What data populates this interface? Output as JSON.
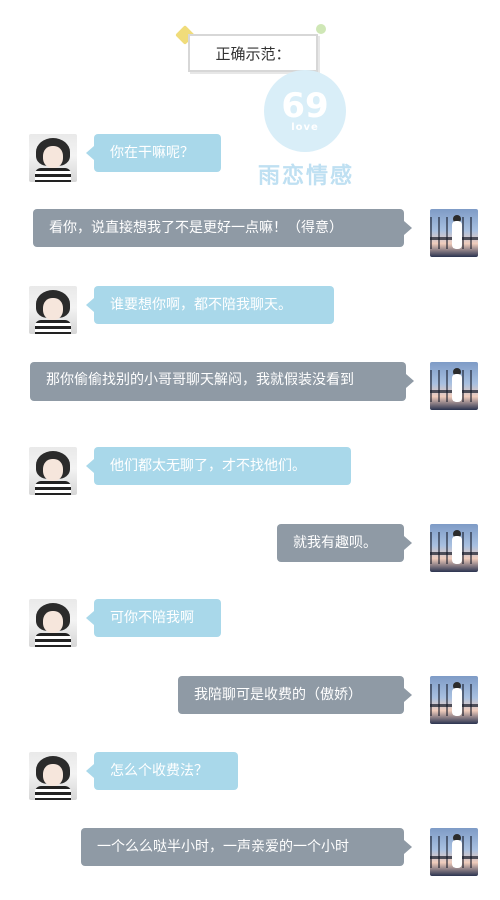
{
  "header": {
    "title": "正确示范："
  },
  "watermark": {
    "number": "69",
    "small_text": "love",
    "brand": "雨恋情感"
  },
  "colors": {
    "left_bubble": "#a9d8ea",
    "right_bubble": "#8f9aa5",
    "bubble_text": "#ffffff"
  },
  "messages": [
    {
      "side": "left",
      "avatar": "female-avatar",
      "text": "你在干嘛呢？"
    },
    {
      "side": "right",
      "avatar": "male-avatar",
      "text": "看你，说直接想我了不是更好一点嘛！（得意）"
    },
    {
      "side": "left",
      "avatar": "female-avatar",
      "text": "谁要想你啊，都不陪我聊天。"
    },
    {
      "side": "right",
      "avatar": "male-avatar",
      "text": "那你偷偷找别的小哥哥聊天解闷，我就假装没看到"
    },
    {
      "side": "left",
      "avatar": "female-avatar",
      "text": "他们都太无聊了，才不找他们。"
    },
    {
      "side": "right",
      "avatar": "male-avatar",
      "text": "就我有趣呗。"
    },
    {
      "side": "left",
      "avatar": "female-avatar",
      "text": "可你不陪我啊"
    },
    {
      "side": "right",
      "avatar": "male-avatar",
      "text": "我陪聊可是收费的（傲娇）"
    },
    {
      "side": "left",
      "avatar": "female-avatar",
      "text": "怎么个收费法？"
    },
    {
      "side": "right",
      "avatar": "male-avatar",
      "text": "一个么么哒半小时，一声亲爱的一个小时"
    }
  ]
}
